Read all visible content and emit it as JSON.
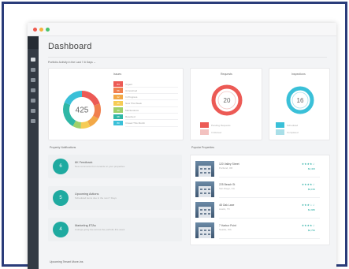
{
  "window": {
    "controls": [
      {
        "name": "close",
        "color": "#ef5a4f"
      },
      {
        "name": "minimize",
        "color": "#f5b13d"
      },
      {
        "name": "maximize",
        "color": "#49c26a"
      }
    ]
  },
  "sidebar": {
    "items": [
      {
        "name": "sidebar-item-dashboard",
        "icon": "grid-icon",
        "active": true
      },
      {
        "name": "sidebar-item-properties",
        "icon": "pencil-icon"
      },
      {
        "name": "sidebar-item-tenants",
        "icon": "user-icon"
      },
      {
        "name": "sidebar-item-reports",
        "icon": "gear-icon"
      },
      {
        "name": "sidebar-item-messages",
        "icon": "grid-icon"
      },
      {
        "name": "sidebar-item-files",
        "icon": "document-icon"
      },
      {
        "name": "sidebar-item-settings",
        "icon": "gear-icon"
      }
    ]
  },
  "header": {
    "title": "Dashboard",
    "filter_text": "Portfolio Activity in the Last 7-6 Days ⌄"
  },
  "cards": {
    "issues": {
      "title": "Issues",
      "total": "425",
      "legend": [
        {
          "count": "84",
          "label": "Urgent",
          "color": "#ec5a55"
        },
        {
          "count": "56",
          "label": "Unresolved",
          "color": "#f07f4e"
        },
        {
          "count": "42",
          "label": "In Progress",
          "color": "#f2a847"
        },
        {
          "count": "35",
          "label": "New This Week",
          "color": "#f6cc55"
        },
        {
          "count": "30",
          "label": "Maintenance",
          "color": "#9fd06a"
        },
        {
          "count": "98",
          "label": "Resolved",
          "color": "#2fb7a6"
        },
        {
          "count": "80",
          "label": "Closed This Month",
          "color": "#3ac0d8"
        }
      ]
    },
    "requests": {
      "title": "Requests",
      "total": "20",
      "legend": [
        {
          "count": "12",
          "label": "Pending Requests",
          "color": "#ec5a55"
        },
        {
          "count": "8",
          "label": "In Review",
          "color": "#f3c2c0"
        }
      ]
    },
    "inspections": {
      "title": "Inspections",
      "total": "16",
      "legend": [
        {
          "count": "10",
          "label": "Scheduled",
          "color": "#3ac0d8"
        },
        {
          "count": "6",
          "label": "Completed",
          "color": "#a9dfe8"
        }
      ]
    }
  },
  "notifications": {
    "title": "Property Notifications",
    "items": [
      {
        "initial": "6",
        "title": "6K Feedback",
        "desc": "New comments from tenants on your properties"
      },
      {
        "initial": "5",
        "title": "Upcoming Actions",
        "desc": "Scheduled items due in the next 7 Days"
      },
      {
        "initial": "4",
        "title": "Marketing ETAs",
        "desc": "Listings going live across the portfolio this week"
      }
    ]
  },
  "properties": {
    "title": "Popular Properties",
    "items": [
      {
        "name": "120 Valley Street",
        "location": "Portland, OR",
        "stars": "★★★★☆",
        "price": "$2,400"
      },
      {
        "name": "225 Beach St",
        "location": "San Diego, CA",
        "stars": "★★★★☆",
        "price": "$3,150"
      },
      {
        "name": "48 Oak Lane",
        "location": "Austin, TX",
        "stars": "★★★☆☆",
        "price": "$1,980"
      },
      {
        "name": "7 Harbor Point",
        "location": "Seattle, WA",
        "stars": "★★★★☆",
        "price": "$2,750"
      }
    ]
  },
  "footer": {
    "title": "Upcoming Tenant Move-Ins"
  }
}
